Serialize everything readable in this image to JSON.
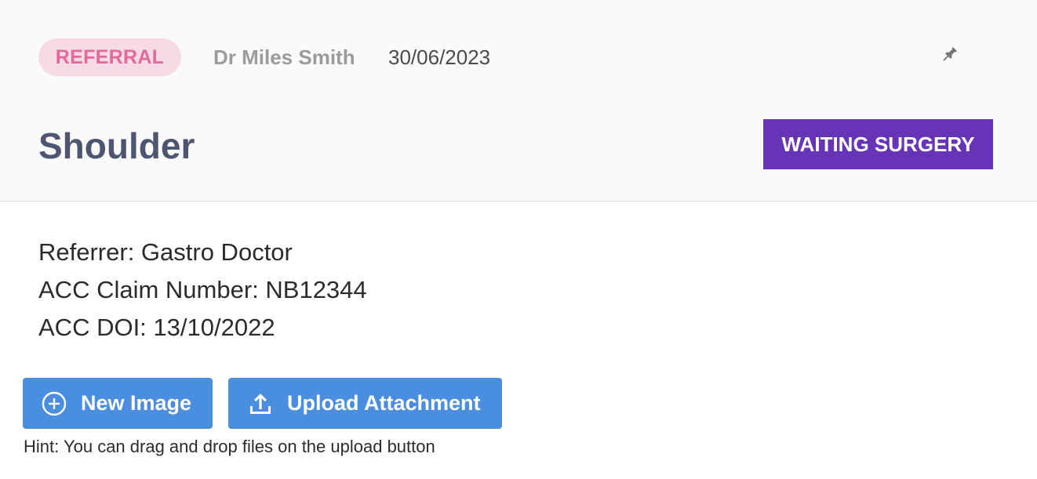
{
  "header": {
    "type_badge": "REFERRAL",
    "author": "Dr Miles Smith",
    "date": "30/06/2023",
    "pin_icon": "pin-icon",
    "title": "Shoulder",
    "status": "WAITING SURGERY"
  },
  "details": {
    "referrer": "Referrer: Gastro Doctor",
    "claim_number": "ACC Claim Number: NB12344",
    "doi": "ACC DOI: 13/10/2022"
  },
  "actions": {
    "new_image_label": "New Image",
    "new_image_icon": "plus-circle-icon",
    "upload_label": "Upload Attachment",
    "upload_icon": "upload-icon"
  },
  "hint": "Hint: You can drag and drop files on the upload button",
  "colors": {
    "badge_bg": "#f8d9e6",
    "badge_text": "#e06a9c",
    "status_bg": "#6734b8",
    "button_bg": "#4a8ee0",
    "title_text": "#4d5570"
  }
}
